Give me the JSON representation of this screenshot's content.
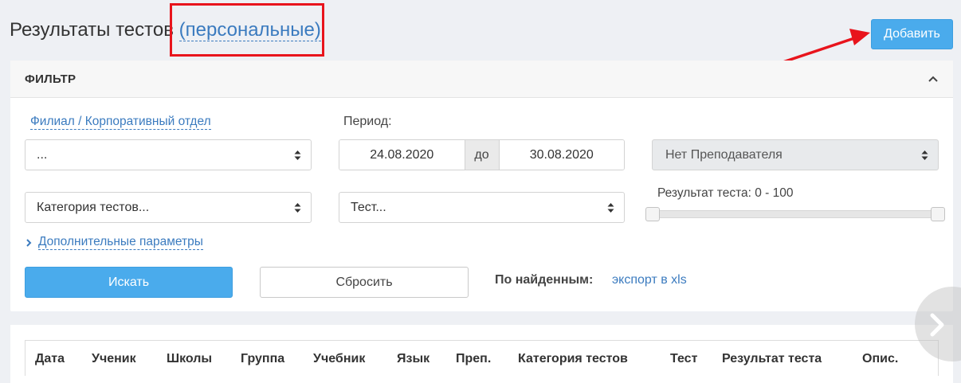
{
  "header": {
    "title": "Результаты тестов",
    "scope_link": "(персональные)",
    "add_button": "Добавить"
  },
  "filter": {
    "title": "ФИЛЬТР",
    "branch_link": "Филиал / Корпоративный отдел",
    "branch_select": "...",
    "period_label": "Период:",
    "date_from": "24.08.2020",
    "date_sep": "до",
    "date_to": "30.08.2020",
    "teacher_select": "Нет Преподавателя",
    "category_select": "Категория тестов...",
    "test_select": "Тест...",
    "result_label": "Результат теста: 0 - 100",
    "result_range": [
      0,
      100
    ],
    "extra_params_link": "Дополнительные параметры",
    "search_button": "Искать",
    "reset_button": "Сбросить",
    "found_label": "По найденным:",
    "export_link": "экспорт в xls"
  },
  "table": {
    "columns": [
      "Дата",
      "Ученик",
      "Школы",
      "Группа",
      "Учебник",
      "Язык",
      "Преп.",
      "Категория тестов",
      "Тест",
      "Результат теста",
      "Опис."
    ]
  },
  "colors": {
    "accent": "#4aabec",
    "link": "#3b7bbf",
    "annotation": "#e8141c"
  }
}
